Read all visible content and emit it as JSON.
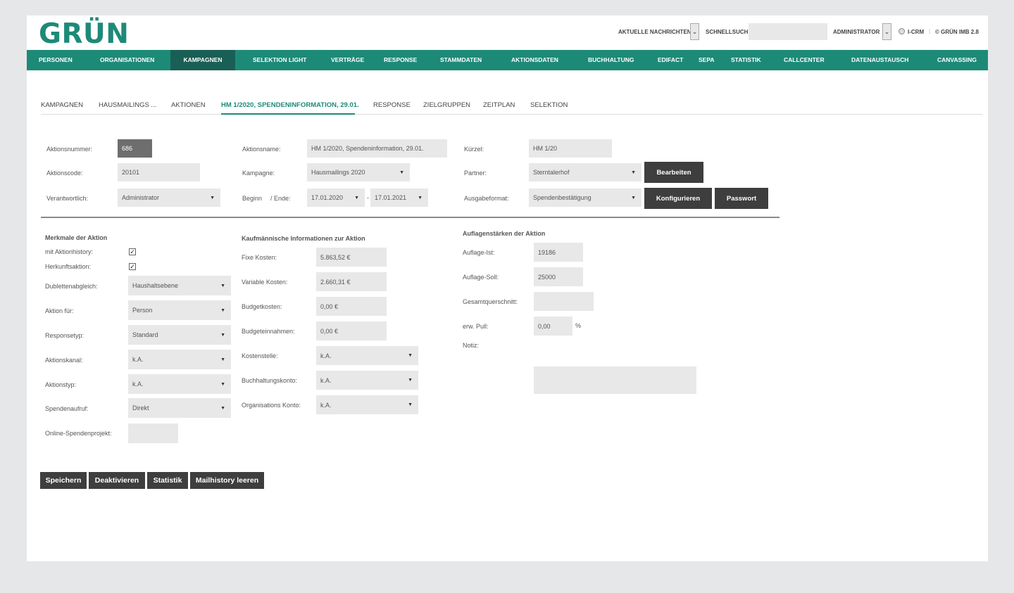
{
  "header": {
    "logo": "GRÜN",
    "news_label": "AKTUELLE NACHRICHTEN",
    "quicksearch_label": "SCHNELLSUCHE:",
    "quicksearch_value": "",
    "user_label": "ADMINISTRATOR",
    "icrm_label": "I-CRM",
    "separator": "|",
    "version_label": "© GRÜN IMB 2.8"
  },
  "nav": {
    "items": [
      "PERSONEN",
      "ORGANISATIONEN",
      "KAMPAGNEN",
      "SELEKTION LIGHT",
      "VERTRÄGE",
      "RESPONSE",
      "STAMMDATEN",
      "AKTIONSDATEN",
      "BUCHHALTUNG",
      "EDIFACT",
      "SEPA",
      "STATISTIK",
      "CALLCENTER",
      "DATENAUSTAUSCH",
      "CANVASSING"
    ],
    "active": "KAMPAGNEN"
  },
  "tabs": {
    "items": [
      "KAMPAGNEN",
      "HAUSMAILINGS ...",
      "AKTIONEN",
      "HM 1/2020, SPENDENINFORMATION, 29.01.",
      "RESPONSE",
      "ZIELGRUPPEN",
      "ZEITPLAN",
      "SELEKTION"
    ],
    "active": "HM 1/2020, SPENDENINFORMATION, 29.01."
  },
  "top_form": {
    "aktionsnummer_label": "Aktionsnummer:",
    "aktionsnummer": "686",
    "aktionscode_label": "Aktionscode:",
    "aktionscode": "20101",
    "verantwortlich_label": "Verantwortlich:",
    "verantwortlich": "Administrator",
    "aktionsname_label": "Aktionsname:",
    "aktionsname": "HM 1/2020, Spendeninformation, 29.01.",
    "kampagne_label": "Kampagne:",
    "kampagne": "Hausmailings 2020",
    "beginn_label": "Beginn",
    "ende_label": "/ Ende:",
    "beginn": "17.01.2020",
    "date_sep": "-",
    "ende": "17.01.2021",
    "kuerzel_label": "Kürzel:",
    "kuerzel": "HM 1/20",
    "partner_label": "Partner:",
    "partner": "Sterntalerhof",
    "ausgabeformat_label": "Ausgabeformat:",
    "ausgabeformat": "Spendenbestätigung",
    "bearbeiten": "Bearbeiten",
    "konfigurieren": "Konfigurieren",
    "passwort": "Passwort"
  },
  "merkmale": {
    "title": "Merkmale der Aktion",
    "aktionhistory_label": "mit Aktionhistory:",
    "aktionhistory": true,
    "herkunft_label": "Herkunftsaktion:",
    "herkunft": true,
    "check_mark": "✓",
    "dubletten_label": "Dublettenabgleich:",
    "dubletten": "Haushaltsebene",
    "aktion_fuer_label": "Aktion für:",
    "aktion_fuer": "Person",
    "responsetyp_label": "Responsetyp:",
    "responsetyp": "Standard",
    "aktionskanal_label": "Aktionskanal:",
    "aktionskanal": "k.A.",
    "aktionstyp_label": "Aktionstyp:",
    "aktionstyp": "k.A.",
    "spendenaufruf_label": "Spendenaufruf:",
    "spendenaufruf": "Direkt",
    "online_label": "Online-Spendenprojekt:",
    "online": ""
  },
  "kaufm": {
    "title": "Kaufmännische Informationen zur Aktion",
    "fixe_label": "Fixe Kosten:",
    "fixe": "5.863,52 €",
    "variable_label": "Variable Kosten:",
    "variable": "2.660,31 €",
    "budgetkosten_label": "Budgetkosten:",
    "budgetkosten": "0,00 €",
    "budgeteinnahmen_label": "Budgeteinnahmen:",
    "budgeteinnahmen": "0,00 €",
    "kostenstelle_label": "Kostenstelle:",
    "kostenstelle": "k.A.",
    "buchhaltung_label": "Buchhaltungskonto:",
    "buchhaltung": "k.A.",
    "orgkonto_label": "Organisations Konto:",
    "orgkonto": "k.A."
  },
  "auflagen": {
    "title": "Auflagenstärken der Aktion",
    "ist_label": "Auflage-Ist:",
    "ist": "19186",
    "soll_label": "Auflage-Soll:",
    "soll": "25000",
    "gesamt_label": "Gesamtquerschnitt:",
    "gesamt": "",
    "pull_label": "erw. Pull:",
    "pull": "0,00",
    "pull_unit": "%",
    "notiz_label": "Notiz:",
    "notiz": ""
  },
  "footer_buttons": {
    "speichern": "Speichern",
    "deaktivieren": "Deaktivieren",
    "statistik": "Statistik",
    "mailhistory": "Mailhistory leeren"
  }
}
